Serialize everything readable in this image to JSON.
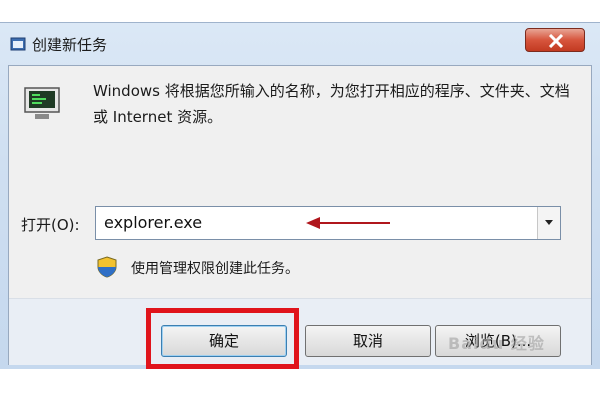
{
  "window": {
    "title": "创建新任务"
  },
  "dialog": {
    "description": "Windows 将根据您所输入的名称，为您打开相应的程序、文件夹、文档或 Internet 资源。",
    "open_label": "打开(O):",
    "open_value": "explorer.exe",
    "admin_note": "使用管理权限创建此任务。"
  },
  "buttons": {
    "ok": "确定",
    "cancel": "取消",
    "browse": "浏览(B)..."
  },
  "watermark": "Baidu 经验",
  "colors": {
    "highlight": "#e0141c",
    "close": "#c23a21",
    "annotation_arrow": "#b0161c"
  }
}
